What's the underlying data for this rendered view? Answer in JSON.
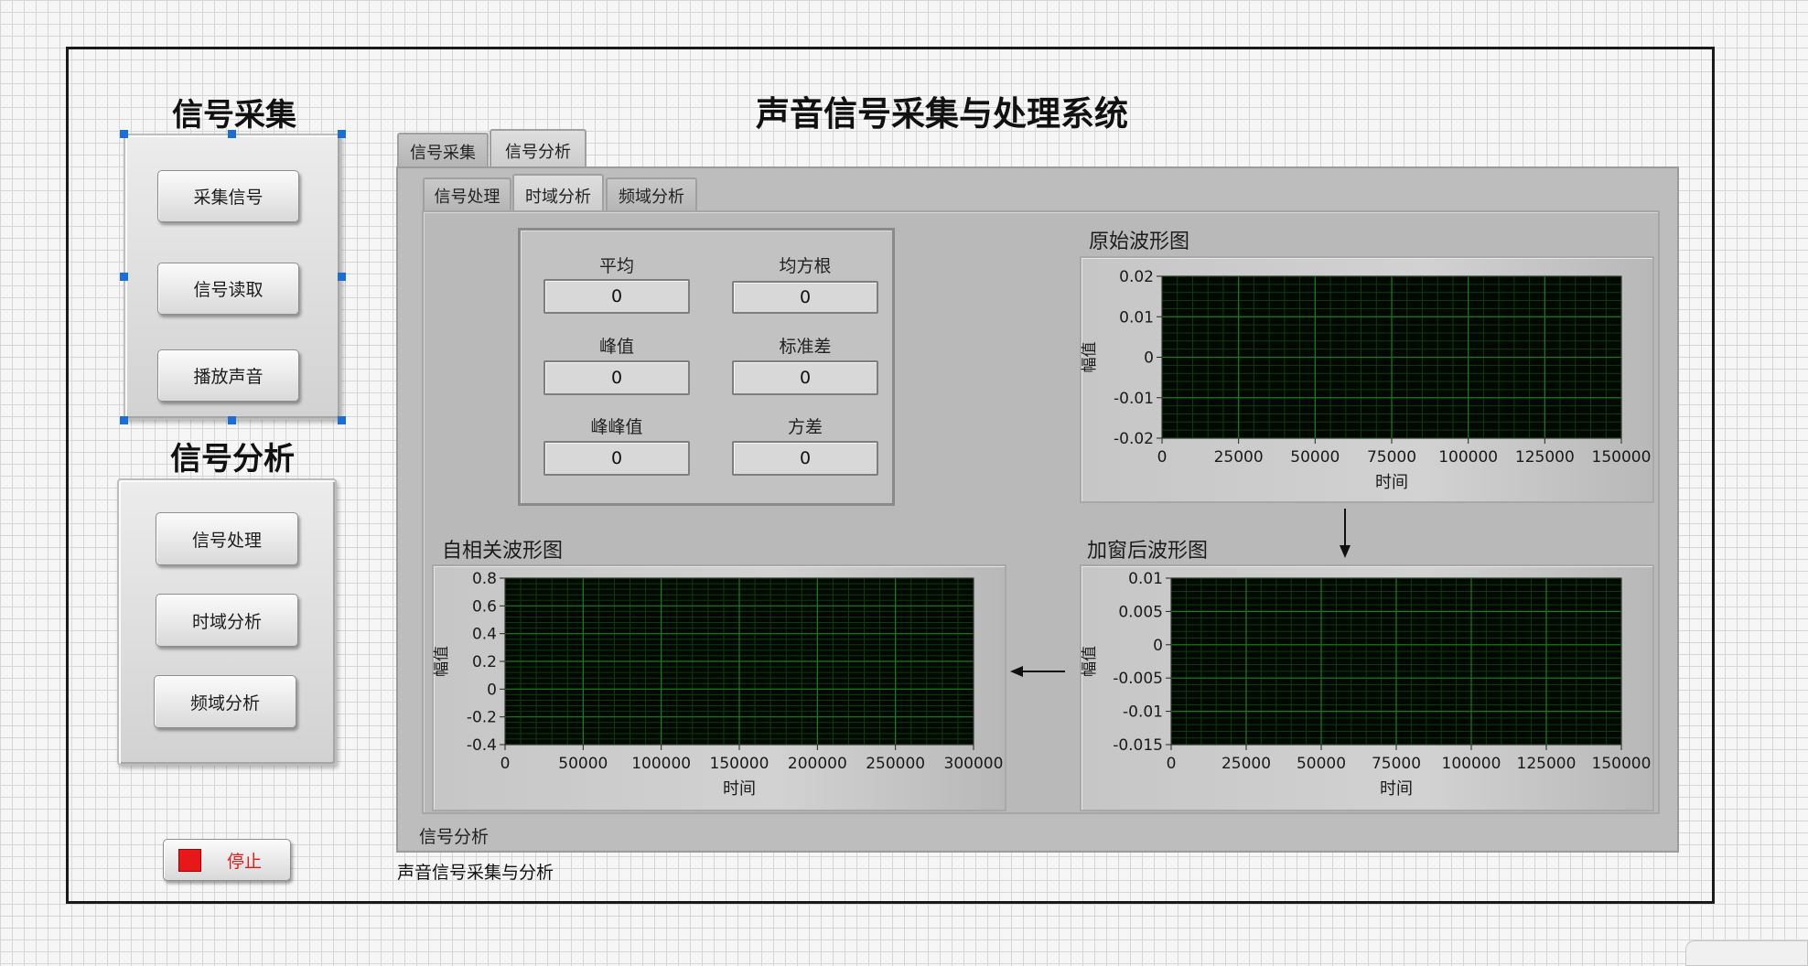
{
  "main_title": "声音信号采集与处理系统",
  "left": {
    "acquire_title": "信号采集",
    "acquire_buttons": [
      "采集信号",
      "信号读取",
      "播放声音"
    ],
    "analysis_title": "信号分析",
    "analysis_buttons": [
      "信号处理",
      "时域分析",
      "频域分析"
    ],
    "stop_label": "停止"
  },
  "outer_tabs": [
    "信号采集",
    "信号分析"
  ],
  "outer_active": "信号分析",
  "inner_tabs": [
    "信号处理",
    "时域分析",
    "频域分析"
  ],
  "inner_active": "时域分析",
  "stats": {
    "mean_label": "平均",
    "mean_value": "0",
    "rms_label": "均方根",
    "rms_value": "0",
    "peak_label": "峰值",
    "peak_value": "0",
    "std_label": "标准差",
    "std_value": "0",
    "p2p_label": "峰峰值",
    "p2p_value": "0",
    "var_label": "方差",
    "var_value": "0"
  },
  "colors": {
    "plot_bg": "#020802",
    "grid_major": "#1d7a1d",
    "grid_minor": "#0f3a0f",
    "stop_red": "#e81818",
    "handle_blue": "#1a6fd6"
  },
  "chart_data": [
    {
      "type": "line",
      "title": "原始波形图",
      "xlabel": "时间",
      "ylabel": "幅值",
      "xlim": [
        0,
        150000
      ],
      "ylim": [
        -0.02,
        0.02
      ],
      "x_ticks": [
        "0",
        "25000",
        "50000",
        "75000",
        "100000",
        "125000",
        "150000"
      ],
      "y_ticks": [
        "0.02",
        "0.01",
        "0",
        "-0.01",
        "-0.02"
      ],
      "series": []
    },
    {
      "type": "line",
      "title": "加窗后波形图",
      "xlabel": "时间",
      "ylabel": "幅值",
      "xlim": [
        0,
        150000
      ],
      "ylim": [
        -0.015,
        0.01
      ],
      "x_ticks": [
        "0",
        "25000",
        "50000",
        "75000",
        "100000",
        "125000",
        "150000"
      ],
      "y_ticks": [
        "0.01",
        "0.005",
        "0",
        "-0.005",
        "-0.01",
        "-0.015"
      ],
      "series": []
    },
    {
      "type": "line",
      "title": "自相关波形图",
      "xlabel": "时间",
      "ylabel": "幅值",
      "xlim": [
        0,
        300000
      ],
      "ylim": [
        -0.4,
        0.8
      ],
      "x_ticks": [
        "0",
        "50000",
        "100000",
        "150000",
        "200000",
        "250000",
        "300000"
      ],
      "y_ticks": [
        "0.8",
        "0.6",
        "0.4",
        "0.2",
        "0",
        "-0.2",
        "-0.4"
      ],
      "series": []
    }
  ],
  "footer": {
    "panel_label": "信号分析",
    "caption": "声音信号采集与分析"
  }
}
